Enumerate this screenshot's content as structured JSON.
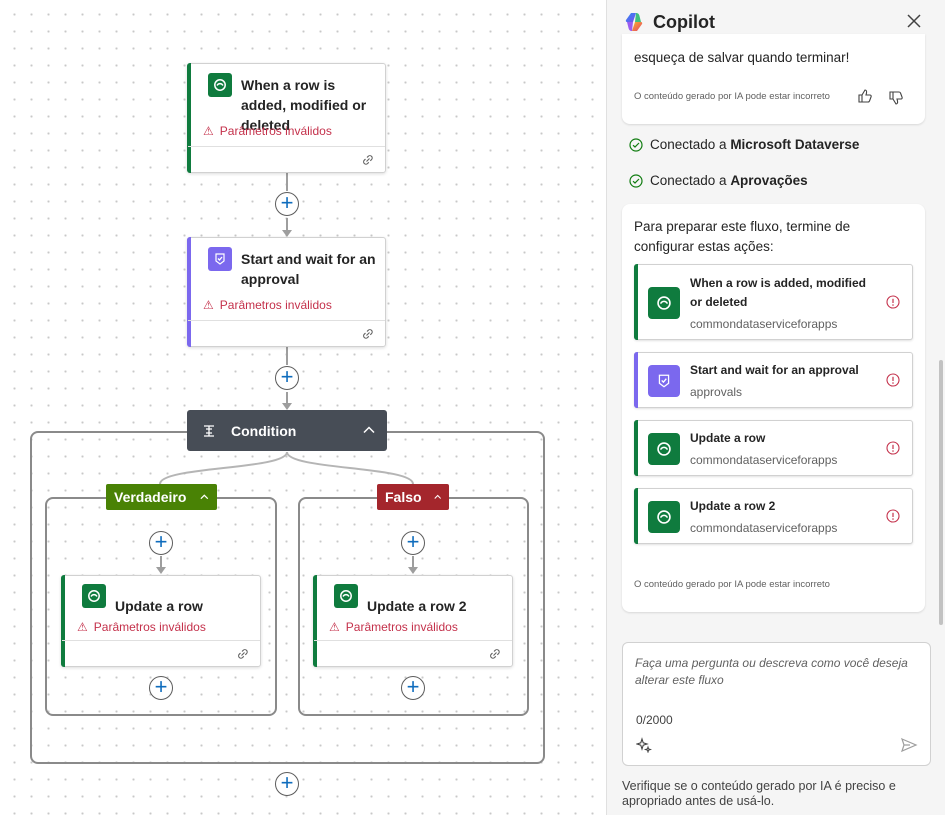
{
  "canvas": {
    "trigger": {
      "title": "When a row is added, modified or deleted",
      "error": "Parâmetros inválidos",
      "icon": "dataverse-icon"
    },
    "approval": {
      "title": "Start and wait for an approval",
      "error": "Parâmetros inválidos",
      "icon": "approvals-icon"
    },
    "condition": {
      "title": "Condition"
    },
    "true_branch": {
      "label": "Verdadeiro",
      "color": "#498205",
      "action": {
        "title": "Update a row",
        "error": "Parâmetros inválidos"
      }
    },
    "false_branch": {
      "label": "Falso",
      "color": "#a4262c",
      "action": {
        "title": "Update a row 2",
        "error": "Parâmetros inválidos"
      }
    },
    "colors": {
      "dataverse": "#0f7b3e",
      "approvals": "#7b68ee",
      "condition": "#474d56",
      "plus": "#0f6cbd",
      "error": "#c4314b"
    }
  },
  "copilot": {
    "title": "Copilot",
    "previous_message_tail": "esqueça de salvar quando terminar!",
    "ai_disclaimer": "O conteúdo gerado por IA pode estar incorreto",
    "connections": [
      {
        "prefix": "Conectado a ",
        "name": "Microsoft Dataverse"
      },
      {
        "prefix": "Conectado a ",
        "name": "Aprovações"
      }
    ],
    "setup_message": "Para preparar este fluxo, termine de configurar estas ações:",
    "actions": [
      {
        "title": "When a row is added, modified or deleted",
        "connector": "commondataserviceforapps",
        "icon": "dataverse-icon"
      },
      {
        "title": "Start and wait for an approval",
        "connector": "approvals",
        "icon": "approvals-icon"
      },
      {
        "title": "Update a row",
        "connector": "commondataserviceforapps",
        "icon": "dataverse-icon"
      },
      {
        "title": "Update a row 2",
        "connector": "commondataserviceforapps",
        "icon": "dataverse-icon"
      }
    ],
    "input": {
      "placeholder": "Faça uma pergunta ou descreva como você deseja alterar este fluxo",
      "counter": "0/2000"
    },
    "footer_note": "Verifique se o conteúdo gerado por IA é preciso e apropriado antes de usá-lo."
  }
}
